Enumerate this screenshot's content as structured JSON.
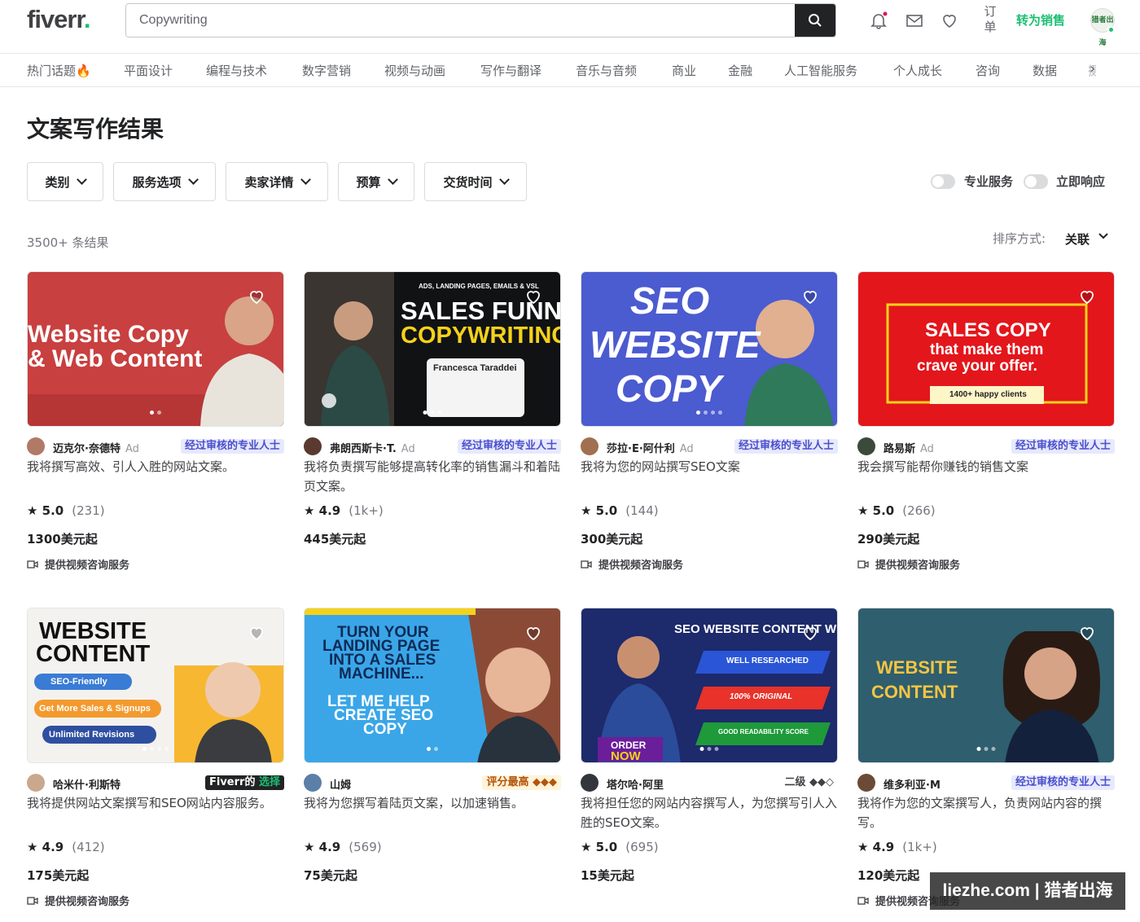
{
  "header": {
    "logo": "fiverr",
    "logo_dot": ".",
    "search_value": "Copywriting",
    "orders": "订单",
    "become_seller": "转为销售",
    "user_avatar_text": "猎者出海"
  },
  "categories": [
    "热门话题🔥",
    "平面设计",
    "编程与技术",
    "数字营销",
    "视频与动画",
    "写作与翻译",
    "音乐与音频",
    "商业",
    "金融",
    "人工智能服务",
    "个人成长",
    "咨询",
    "数据",
    "摄"
  ],
  "page_title": "文案写作结果",
  "filters": [
    "类别",
    "服务选项",
    "卖家详情",
    "预算",
    "交货时间"
  ],
  "toggles": {
    "pro": "专业服务",
    "instant": "立即响应"
  },
  "results_count": "3500+ 条结果",
  "sort": {
    "label": "排序方式:",
    "value": "关联"
  },
  "gigs": [
    {
      "seller": "迈克尔·奈德特",
      "ad": "Ad",
      "badge": "经过审核的专业人士",
      "badge_type": "pro",
      "title": "我将撰写高效、引人入胜的网站文案。",
      "rating": "5.0",
      "reviews": "(231)",
      "price": "1300美元起",
      "consult": "提供视频咨询服务",
      "thumb_lines": [
        "Website Copy",
        "& Web Content"
      ],
      "thumb_bg": "#c8403f",
      "avatar_color": "#b07a66"
    },
    {
      "seller": "弗朗西斯卡·T.",
      "ad": "Ad",
      "badge": "经过审核的专业人士",
      "badge_type": "pro",
      "title": "我将负责撰写能够提高转化率的销售漏斗和着陆页文案。",
      "rating": "4.9",
      "reviews": "(1k+)",
      "price": "445美元起",
      "consult": "",
      "thumb_lines": [
        "ADS, LANDING PAGES, EMAILS & VSL",
        "SALES FUNNEL",
        "COPYWRITING",
        "Francesca Taraddei"
      ],
      "thumb_bg": "#111214",
      "avatar_color": "#5a3a2e"
    },
    {
      "seller": "莎拉·E·阿什利",
      "ad": "Ad",
      "badge": "经过审核的专业人士",
      "badge_type": "pro",
      "title": "我将为您的网站撰写SEO文案",
      "rating": "5.0",
      "reviews": "(144)",
      "price": "300美元起",
      "consult": "提供视频咨询服务",
      "thumb_lines": [
        "SEO",
        "WEBSITE",
        "COPY"
      ],
      "thumb_bg": "#4b5bd0",
      "avatar_color": "#a07050"
    },
    {
      "seller": "路易斯",
      "ad": "Ad",
      "badge": "经过审核的专业人士",
      "badge_type": "pro",
      "title": "我会撰写能帮你赚钱的销售文案",
      "rating": "5.0",
      "reviews": "(266)",
      "price": "290美元起",
      "consult": "提供视频咨询服务",
      "thumb_lines": [
        "SALES COPY",
        "that make them",
        "crave your offer.",
        "1400+ happy clients"
      ],
      "thumb_bg": "#e3161b",
      "avatar_color": "#3b4a3a"
    },
    {
      "seller": "哈米什·利斯特",
      "ad": "",
      "badge": "Fiverr的",
      "badge_choice": "选择",
      "badge_type": "choice",
      "title": "我将提供网站文案撰写和SEO网站内容服务。",
      "rating": "4.9",
      "reviews": "(412)",
      "price": "175美元起",
      "consult": "提供视频咨询服务",
      "thumb_lines": [
        "WEBSITE",
        "CONTENT",
        "SEO-Friendly",
        "Get More Sales & Signups",
        "Unlimited Revisions"
      ],
      "thumb_bg": "#f4f2ee",
      "avatar_color": "#c9a88d"
    },
    {
      "seller": "山姆",
      "ad": "",
      "badge": "评分最高 ◆◆◆",
      "badge_type": "top",
      "title": "我将为您撰写着陆页文案，以加速销售。",
      "rating": "4.9",
      "reviews": "(569)",
      "price": "75美元起",
      "consult": "",
      "thumb_lines": [
        "TURN YOUR",
        "LANDING PAGE",
        "INTO A SALES",
        "MACHINE...",
        "LET ME HELP",
        "CREATE SEO",
        "COPY"
      ],
      "thumb_bg": "#3aa6e8",
      "avatar_color": "#5c7fa8"
    },
    {
      "seller": "塔尔哈·阿里",
      "ad": "",
      "badge": "二级 ◆◆◇",
      "badge_type": "level",
      "title": "我将担任您的网站内容撰写人，为您撰写引人入胜的SEO文案。",
      "rating": "5.0",
      "reviews": "(695)",
      "price": "15美元起",
      "consult": "",
      "thumb_lines": [
        "SEO WEBSITE CONTENT WRITER",
        "WELL RESEARCHED",
        "100% ORIGINAL",
        "GOOD READABILITY SCORE",
        "ORDER",
        "NOW"
      ],
      "thumb_bg": "#1d2a6b",
      "avatar_color": "#33363d"
    },
    {
      "seller": "维多利亚·M",
      "ad": "",
      "badge": "经过审核的专业人士",
      "badge_type": "pro",
      "title": "我将作为您的文案撰写人，负责网站内容的撰写。",
      "rating": "4.9",
      "reviews": "(1k+)",
      "price": "120美元起",
      "consult": "提供视频咨询服务",
      "thumb_lines": [
        "WEBSITE",
        "CONTENT"
      ],
      "thumb_bg": "#2f5e6e",
      "avatar_color": "#6b4a38"
    }
  ],
  "watermark": "liezhe.com | 猎者出海"
}
